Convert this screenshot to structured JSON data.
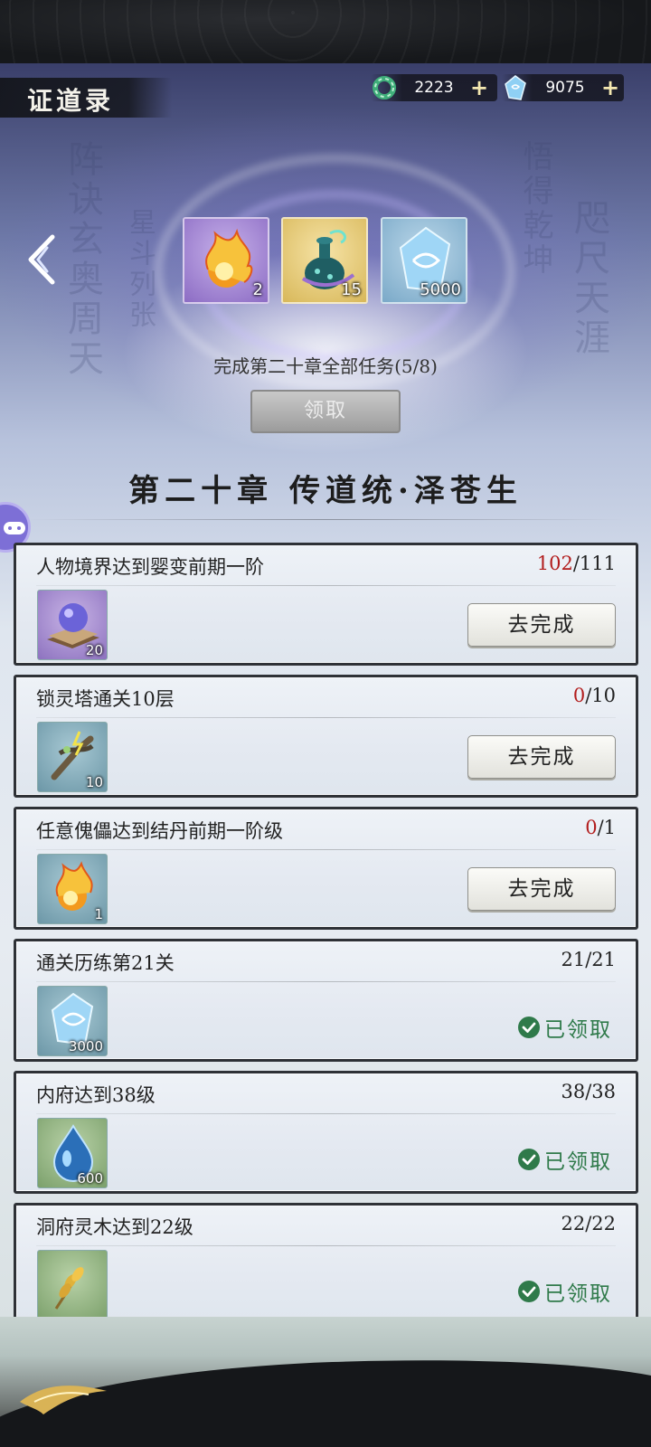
{
  "header": {
    "title": "证道录",
    "currencies": [
      {
        "icon": "jade-ring-icon",
        "amount": "2223",
        "plus": "+"
      },
      {
        "icon": "spirit-crystal-icon",
        "amount": "9075",
        "plus": "+"
      }
    ]
  },
  "chapter_rewards": {
    "items": [
      {
        "icon": "flame-orb-icon",
        "count": "2"
      },
      {
        "icon": "jade-vase-icon",
        "count": "15"
      },
      {
        "icon": "spirit-crystal-icon",
        "count": "5000"
      }
    ],
    "task_text": "完成第二十章全部任务(5/8)",
    "claim_label": "领取"
  },
  "chapter_title": "第二十章 传道统·泽苍生",
  "tasks": [
    {
      "name": "人物境界达到婴变前期一阶",
      "current": "102",
      "total": "/111",
      "reward_icon": "crystal-ball-icon",
      "reward_count": "20",
      "status": "go",
      "button_label": "去完成"
    },
    {
      "name": "锁灵塔通关10层",
      "current": "0",
      "total": "/10",
      "reward_icon": "thunder-wood-icon",
      "reward_count": "10",
      "status": "go",
      "button_label": "去完成"
    },
    {
      "name": "任意傀儡达到结丹前期一阶级",
      "current": "0",
      "total": "/1",
      "reward_icon": "flame-orb-icon",
      "reward_count": "1",
      "status": "go",
      "button_label": "去完成"
    },
    {
      "name": "通关历练第21关",
      "current": "21",
      "total": "/21",
      "reward_icon": "spirit-crystal-icon",
      "reward_count": "3000",
      "status": "claimed",
      "claimed_label": "已领取"
    },
    {
      "name": "内府达到38级",
      "current": "38",
      "total": "/38",
      "reward_icon": "water-drop-icon",
      "reward_count": "600",
      "status": "claimed",
      "claimed_label": "已领取"
    },
    {
      "name": "洞府灵木达到22级",
      "current": "22",
      "total": "/22",
      "reward_icon": "grain-ear-icon",
      "reward_count": "",
      "status": "claimed",
      "claimed_label": "已领取"
    }
  ],
  "colors": {
    "progress_incomplete": "#b21d1d",
    "claimed_green": "#2f7a4a"
  }
}
